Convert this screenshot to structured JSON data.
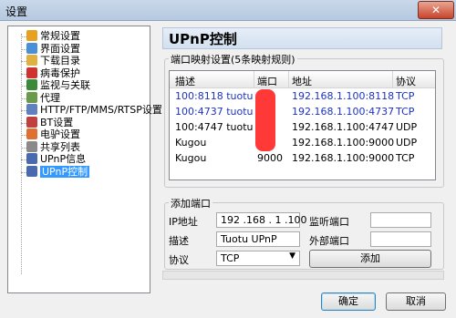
{
  "window": {
    "title": "设置",
    "close_label": "✕"
  },
  "tree": {
    "items": [
      {
        "label": "常规设置",
        "icon": "gear-icon",
        "color": "#e8a020"
      },
      {
        "label": "界面设置",
        "icon": "palette-icon",
        "color": "#4a90d9"
      },
      {
        "label": "下载目录",
        "icon": "folder-icon",
        "color": "#e0b040"
      },
      {
        "label": "病毒保护",
        "icon": "shield-icon",
        "color": "#d03030"
      },
      {
        "label": "监视与关联",
        "icon": "monitor-icon",
        "color": "#3a8a3a"
      },
      {
        "label": "代理",
        "icon": "proxy-icon",
        "color": "#6a9a4a"
      },
      {
        "label": "HTTP/FTP/MMS/RTSP设置",
        "icon": "http-icon",
        "color": "#6080c0"
      },
      {
        "label": "BT设置",
        "icon": "bt-icon",
        "color": "#c04040"
      },
      {
        "label": "电驴设置",
        "icon": "emule-icon",
        "color": "#e07030"
      },
      {
        "label": "共享列表",
        "icon": "share-list-icon",
        "color": "#8a8a8a"
      },
      {
        "label": "UPnP信息",
        "icon": "upnp-info-icon",
        "color": "#4a6ab0"
      },
      {
        "label": "UPnP控制",
        "icon": "upnp-control-icon",
        "color": "#4a6ab0"
      }
    ]
  },
  "panel": {
    "title": "UPnP控制",
    "mapping_group": "端口映射设置(5条映射规则)",
    "columns": [
      "描述",
      "端口",
      "地址",
      "协议"
    ],
    "rows": [
      {
        "desc": "100:8118 tuotu",
        "port": "",
        "addr": "192.168.1.100:8118",
        "proto": "TCP"
      },
      {
        "desc": "100:4737 tuotu",
        "port": "",
        "addr": "192.168.1.100:4737",
        "proto": "TCP"
      },
      {
        "desc": "100:4747 tuotu",
        "port": "",
        "addr": "192.168.1.100:4747",
        "proto": "UDP"
      },
      {
        "desc": "Kugou",
        "port": "",
        "addr": "192.168.1.100:9000",
        "proto": "UDP"
      },
      {
        "desc": "Kugou",
        "port": "9000",
        "addr": "192.168.1.100:9000",
        "proto": "TCP"
      }
    ],
    "add_group": "添加端口",
    "ip_label": "IP地址",
    "ip_value": "192 .168 . 1 .100",
    "listen_label": "监听端口",
    "listen_value": "",
    "desc_label": "描述",
    "desc_value": "Tuotu UPnP",
    "ext_label": "外部端口",
    "ext_value": "",
    "proto_label": "协议",
    "proto_value": "TCP",
    "add_button": "添加"
  },
  "footer": {
    "ok": "确定",
    "cancel": "取消"
  }
}
